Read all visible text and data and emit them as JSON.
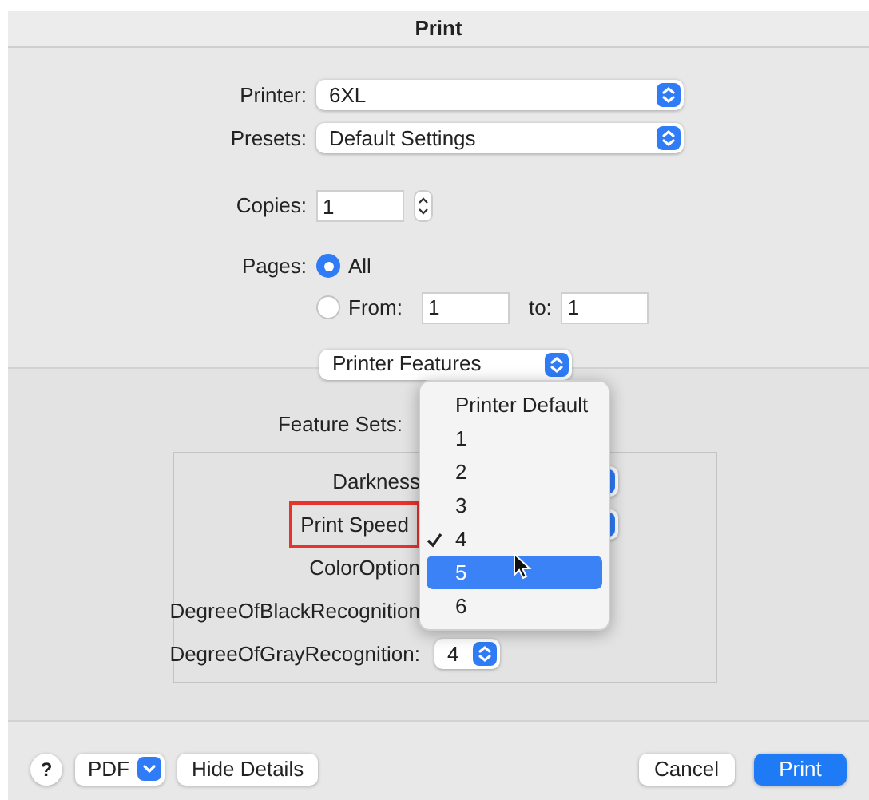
{
  "window": {
    "title": "Print"
  },
  "printer": {
    "label": "Printer:",
    "value": "6XL"
  },
  "presets": {
    "label": "Presets:",
    "value": "Default Settings"
  },
  "copies": {
    "label": "Copies:",
    "value": "1"
  },
  "pages": {
    "label": "Pages:",
    "options": [
      {
        "label": "All",
        "selected": true
      },
      {
        "label": "From:",
        "selected": false
      }
    ],
    "from": "1",
    "to_label": "to:",
    "to": "1"
  },
  "section_popup": {
    "value": "Printer Features"
  },
  "feature_sets": {
    "label": "Feature Sets:"
  },
  "features": [
    {
      "label": "Darkness",
      "highlighted": false
    },
    {
      "label": "Print Speed",
      "highlighted": true
    },
    {
      "label": "ColorOption",
      "highlighted": false
    },
    {
      "label": "DegreeOfBlackRecognition",
      "highlighted": false
    },
    {
      "label": "DegreeOfGrayRecognition:",
      "highlighted": false,
      "value": "4"
    }
  ],
  "menu": {
    "items": [
      {
        "label": "Printer Default",
        "checked": false,
        "selected": false
      },
      {
        "label": "1",
        "checked": false,
        "selected": false
      },
      {
        "label": "2",
        "checked": false,
        "selected": false
      },
      {
        "label": "3",
        "checked": false,
        "selected": false
      },
      {
        "label": "4",
        "checked": true,
        "selected": false
      },
      {
        "label": "5",
        "checked": false,
        "selected": true
      },
      {
        "label": "6",
        "checked": false,
        "selected": false
      }
    ]
  },
  "footer": {
    "help": "?",
    "pdf": "PDF",
    "hide_details": "Hide Details",
    "cancel": "Cancel",
    "print": "Print"
  }
}
